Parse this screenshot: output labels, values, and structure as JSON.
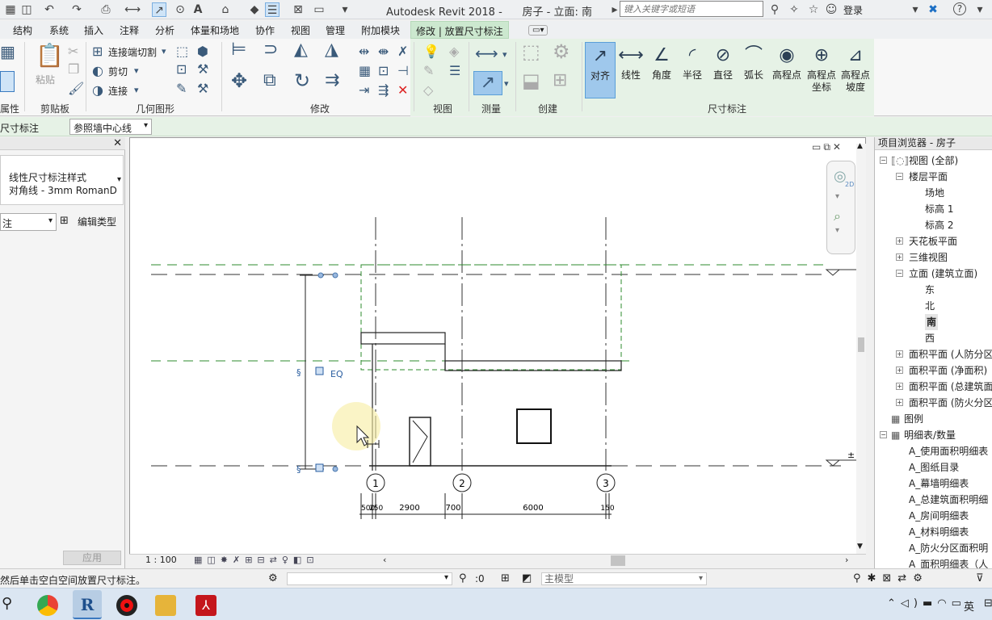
{
  "titlebar": {
    "title": "Autodesk Revit 2018 -      房子 - 立面: 南",
    "search_placeholder": "键入关键字或短语",
    "login": "登录"
  },
  "ribbon_tabs": [
    "结构",
    "系统",
    "插入",
    "注释",
    "分析",
    "体量和场地",
    "协作",
    "视图",
    "管理",
    "附加模块",
    "修改 | 放置尺寸标注"
  ],
  "ribbon": {
    "clipboard": {
      "paste": "粘贴",
      "label": "剪贴板"
    },
    "properties_label": "属性",
    "geometry": {
      "cut_join": "连接端切割",
      "cut": "剪切",
      "join": "连接",
      "label": "几何图形"
    },
    "modify_label": "修改",
    "view_label": "视图",
    "measure_label": "测量",
    "create_label": "创建",
    "dimension_label": "尺寸标注",
    "dimension_tools": [
      {
        "name": "aligned",
        "label": "对齐",
        "label2": "",
        "icon": "↗"
      },
      {
        "name": "linear",
        "label": "线性",
        "label2": "",
        "icon": "⟷"
      },
      {
        "name": "angular",
        "label": "角度",
        "label2": "",
        "icon": "∠"
      },
      {
        "name": "radial",
        "label": "半径",
        "label2": "",
        "icon": "◜"
      },
      {
        "name": "diameter",
        "label": "直径",
        "label2": "",
        "icon": "⊘"
      },
      {
        "name": "arc-length",
        "label": "弧长",
        "label2": "",
        "icon": "⌒"
      },
      {
        "name": "spot-elevation",
        "label": "高程点",
        "label2": "",
        "icon": "◉"
      },
      {
        "name": "spot-coordinate",
        "label": "高程点",
        "label2": "坐标",
        "icon": "⊕"
      },
      {
        "name": "spot-slope",
        "label": "高程点",
        "label2": "坡度",
        "icon": "⊿"
      }
    ]
  },
  "options_bar": {
    "label": "尺寸标注",
    "selected": "参照墙中心线"
  },
  "properties": {
    "type_line1": "线性尺寸标注样式",
    "type_line2": "对角线 - 3mm RomanD",
    "filter_value": "注",
    "edit_type": "编辑类型",
    "apply": "应用"
  },
  "drawing": {
    "grid_labels": [
      "1",
      "2",
      "3"
    ],
    "dimensions": [
      "500",
      "250",
      "2900",
      "700",
      "6000",
      "150"
    ],
    "eq_label": "EQ",
    "level_mark": "±"
  },
  "viewbar": {
    "scale": "1 : 100"
  },
  "browser": {
    "title": "项目浏览器 - 房子",
    "items": [
      {
        "text": "视图 (全部)",
        "level": 0,
        "toggle": "−",
        "icon": "views"
      },
      {
        "text": "楼层平面",
        "level": 1,
        "toggle": "−"
      },
      {
        "text": "场地",
        "level": 2,
        "toggle": ""
      },
      {
        "text": "标高 1",
        "level": 2,
        "toggle": ""
      },
      {
        "text": "标高 2",
        "level": 2,
        "toggle": ""
      },
      {
        "text": "天花板平面",
        "level": 1,
        "toggle": "+"
      },
      {
        "text": "三维视图",
        "level": 1,
        "toggle": "+"
      },
      {
        "text": "立面 (建筑立面)",
        "level": 1,
        "toggle": "−"
      },
      {
        "text": "东",
        "level": 2,
        "toggle": ""
      },
      {
        "text": "北",
        "level": 2,
        "toggle": ""
      },
      {
        "text": "南",
        "level": 2,
        "toggle": "",
        "bold": true
      },
      {
        "text": "西",
        "level": 2,
        "toggle": ""
      },
      {
        "text": "面积平面 (人防分区",
        "level": 1,
        "toggle": "+"
      },
      {
        "text": "面积平面 (净面积)",
        "level": 1,
        "toggle": "+"
      },
      {
        "text": "面积平面 (总建筑面",
        "level": 1,
        "toggle": "+"
      },
      {
        "text": "面积平面 (防火分区",
        "level": 1,
        "toggle": "+"
      },
      {
        "text": "图例",
        "level": 0,
        "toggle": "",
        "icon": "legend"
      },
      {
        "text": "明细表/数量",
        "level": 0,
        "toggle": "−",
        "icon": "schedule"
      },
      {
        "text": "A_使用面积明细表",
        "level": 1,
        "toggle": ""
      },
      {
        "text": "A_图纸目录",
        "level": 1,
        "toggle": ""
      },
      {
        "text": "A_幕墙明细表",
        "level": 1,
        "toggle": ""
      },
      {
        "text": "A_总建筑面积明细",
        "level": 1,
        "toggle": ""
      },
      {
        "text": "A_房间明细表",
        "level": 1,
        "toggle": ""
      },
      {
        "text": "A_材料明细表",
        "level": 1,
        "toggle": ""
      },
      {
        "text": "A_防火分区面积明",
        "level": 1,
        "toggle": ""
      },
      {
        "text": "A_面积明细表（人",
        "level": 1,
        "toggle": ""
      }
    ]
  },
  "statusbar": {
    "text": "然后单击空白空间放置尺寸标注。",
    "zero": ":0",
    "model": "主模型"
  },
  "taskbar": {
    "ime": "英"
  },
  "colors": {
    "accent": "#cce8cf",
    "active_tool": "#9fc8ec",
    "level_line": "#2e8b2e"
  }
}
